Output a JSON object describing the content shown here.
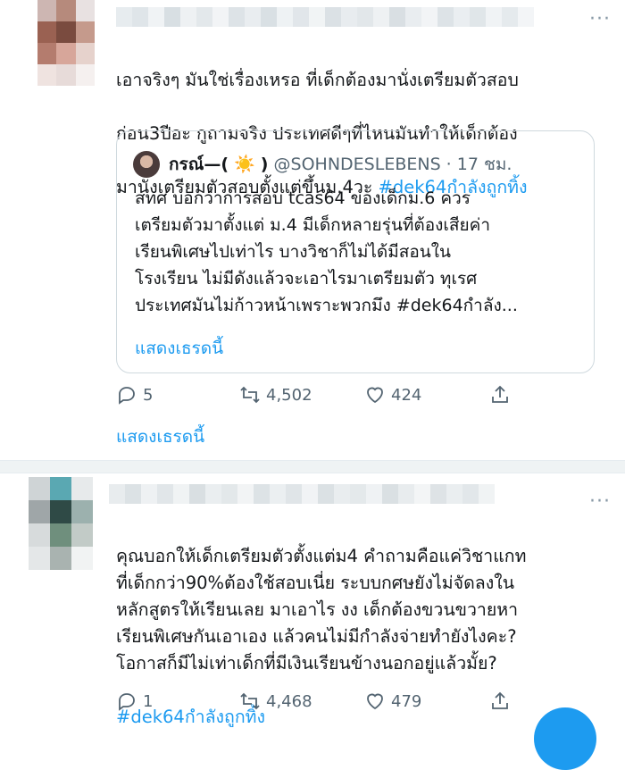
{
  "tweet1": {
    "text_lines": [
      "เอาจริงๆ มันใช่เรื่องเหรอ ที่เด็กต้องมานั่งเตรียมตัวสอบ",
      "ก่อน3ปีอะ กูถามจริง ประเทศดีๆที่ไหนมันทำให้เด็กต้อง"
    ],
    "text_line3_plain": "มานั่งเตรียมตัวสอบตั้งแต่ขึ้นม.4วะ ",
    "hashtag": "#dek64กำลังถูกทิ้ง",
    "quote": {
      "name": "กรณ์—(",
      "sun": "☀️",
      "name_close": ")",
      "handle": "@SOHNDESLEBENS · 17 ชม.",
      "text": "สทศ บอกว่าการสอบ tcas64 ของเด็กม.6 ควร\nเตรียมตัวมาตั้งแต่ ม.4  มีเด็กหลายรุ่นที่ต้องเสียค่า\nเรียนพิเศษไปเท่าไร บางวิชาก็ไม่ได้มีสอนใน\nโรงเรียน ไม่มีดังแล้วจะเอาไรมาเตรียมตัว ทุเรศ\nประเทศมันไม่ก้าวหน้าเพราะพวกมึง #dek64กำลัง...",
      "show_thread": "แสดงเธรดนี้"
    },
    "replies": "5",
    "retweets": "4,502",
    "likes": "424",
    "show_thread": "แสดงเธรดนี้"
  },
  "tweet2": {
    "text": "คุณบอกให้เด็กเตรียมตัวตั้งแต่ม4 คำถามคือแค่วิชาแกท\nที่เด็กกว่า90%ต้องใช้สอบเนี่ย ระบบกศษยังไม่จัดลงใน\nหลักสูตรให้เรียนเลย มาเอาไร งง เด็กต้องขวนขวายหา\nเรียนพิเศษกันเอาเอง แล้วคนไม่มีกำลังจ่ายทำยังไงคะ?\nโอกาสก็มีไม่เท่าเด็กที่มีเงินเรียนข้างนอกอยู่แล้วมั้ย?",
    "hashtag": "#dek64กำลังถูกทิ้ง",
    "replies": "1",
    "retweets": "4,468",
    "likes": "479"
  },
  "icons": {
    "more": "more-dots-icon",
    "reply": "reply-bubble-icon",
    "retweet": "retweet-icon",
    "like": "heart-icon",
    "share": "share-icon"
  },
  "colors": {
    "link": "#1d9bf0",
    "muted": "#536471",
    "separator": "#eff3f4"
  }
}
